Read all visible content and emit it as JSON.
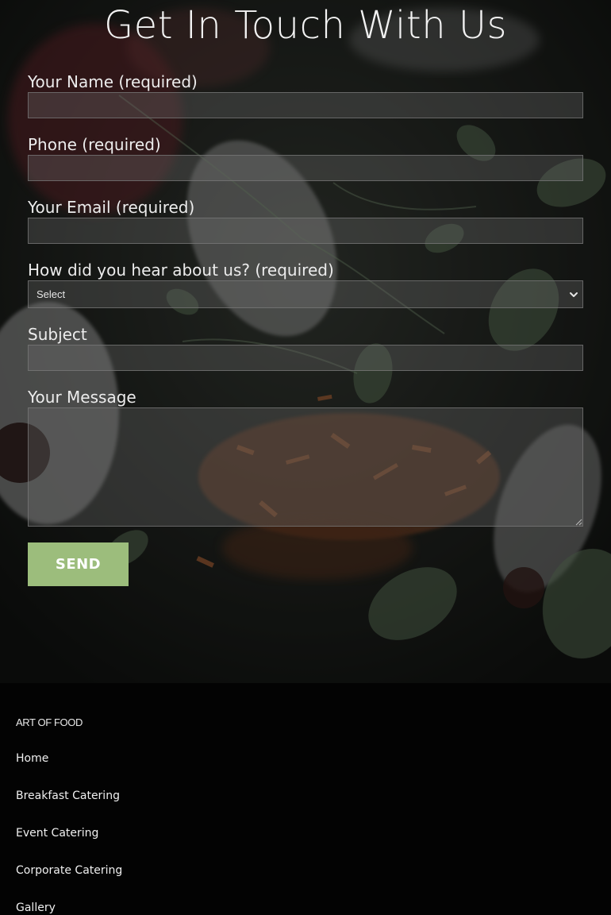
{
  "contact_form": {
    "title": "Get In Touch With Us",
    "name_label": "Your Name (required)",
    "name_value": "",
    "phone_label": "Phone (required)",
    "phone_value": "",
    "email_label": "Your Email (required)",
    "email_value": "",
    "referral_label": "How did you hear about us? (required)",
    "referral_selected": "Select",
    "subject_label": "Subject",
    "subject_value": "",
    "message_label": "Your Message",
    "message_value": "",
    "send_label": "SEND"
  },
  "footer": {
    "brand": "ART OF FOOD",
    "links": [
      {
        "label": "Home"
      },
      {
        "label": "Breakfast Catering"
      },
      {
        "label": "Event Catering"
      },
      {
        "label": "Corporate Catering"
      },
      {
        "label": "Gallery"
      }
    ]
  },
  "colors": {
    "send_button": "#9cbd7c",
    "footer_background": "#030303",
    "label_text": "#ececec"
  },
  "icons": {
    "select_arrow": "chevron-down-icon",
    "textarea_resize": "resize-handle-icon"
  }
}
